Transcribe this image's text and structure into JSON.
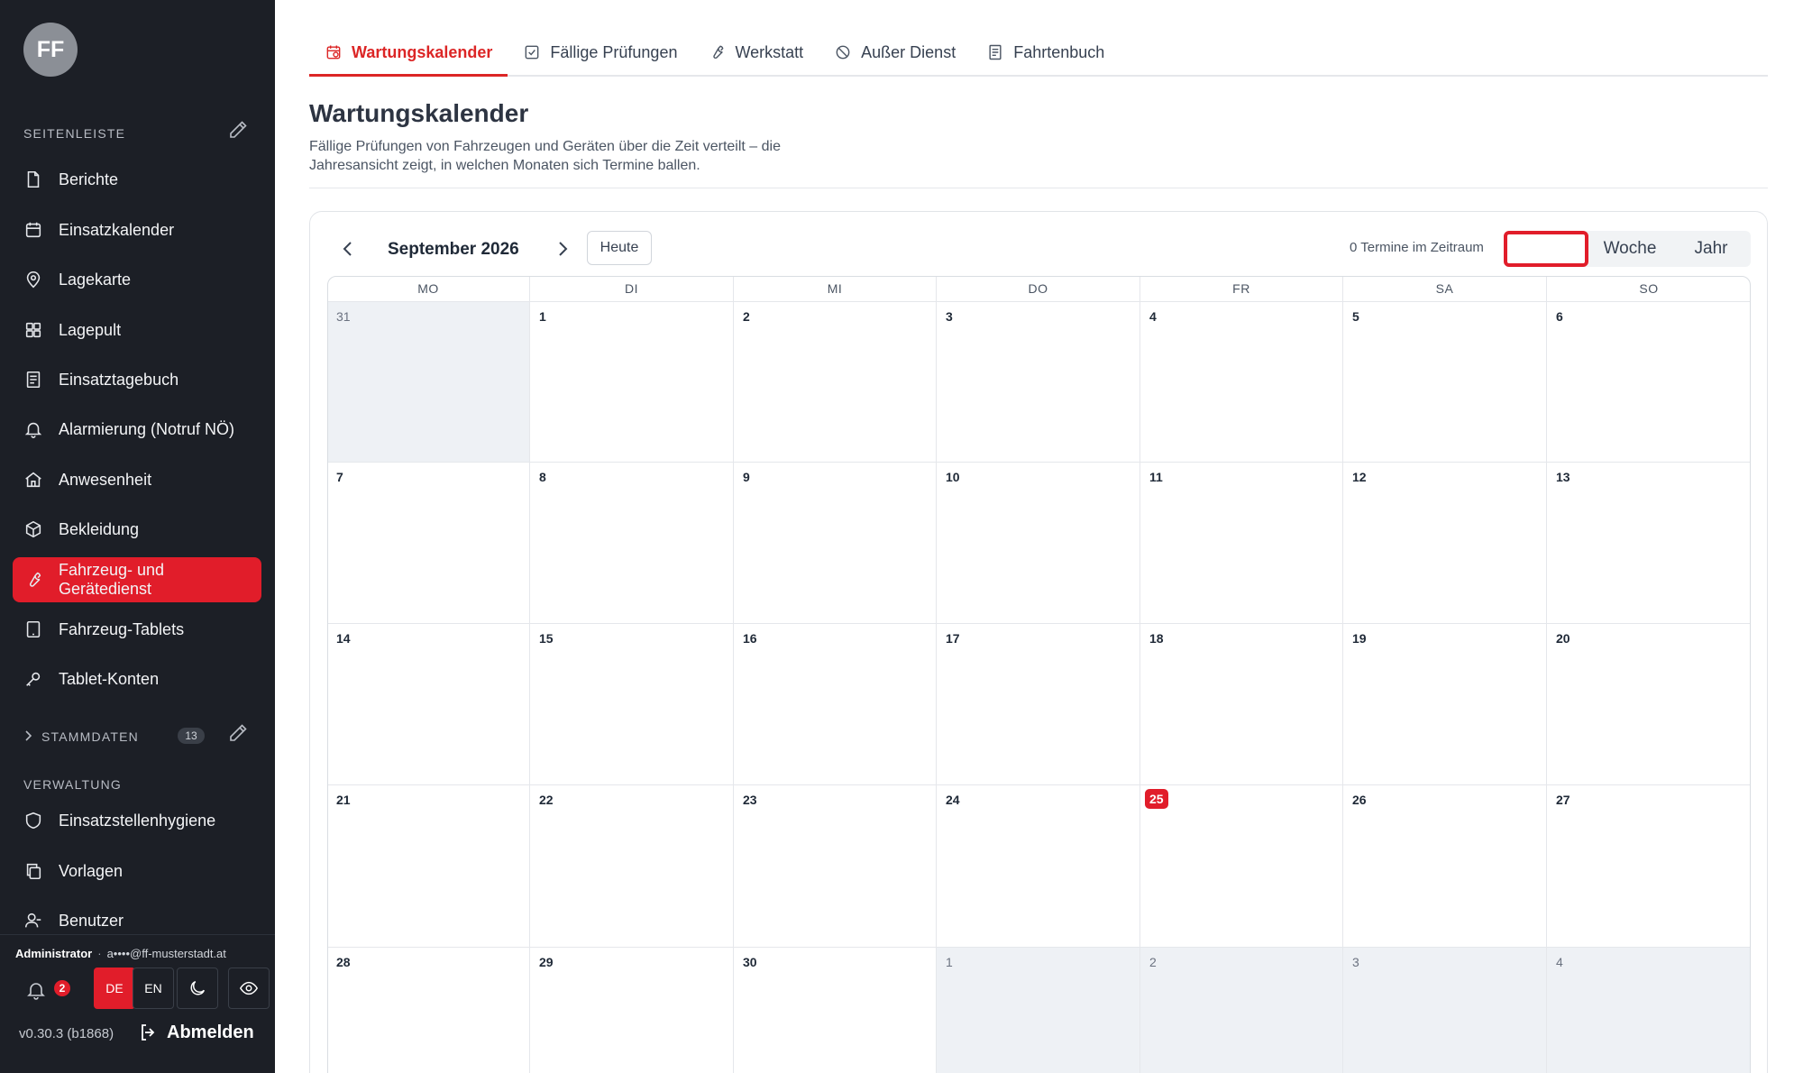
{
  "sidebar": {
    "avatar_initials": "FF",
    "section_label": "SEITENLEISTE",
    "items": [
      {
        "label": "Berichte",
        "icon": "file-icon"
      },
      {
        "label": "Einsatzkalender",
        "icon": "calendar-icon"
      },
      {
        "label": "Lagekarte",
        "icon": "map-pin-icon"
      },
      {
        "label": "Lagepult",
        "icon": "grid-icon"
      },
      {
        "label": "Einsatztagebuch",
        "icon": "notebook-icon"
      },
      {
        "label": "Alarmierung (Notruf NÖ)",
        "icon": "bell-icon"
      },
      {
        "label": "Anwesenheit",
        "icon": "home-icon"
      },
      {
        "label": "Bekleidung",
        "icon": "box-icon"
      },
      {
        "label": "Fahrzeug- und Gerätedienst",
        "icon": "wrench-icon",
        "active": true
      },
      {
        "label": "Fahrzeug-Tablets",
        "icon": "tablet-icon"
      },
      {
        "label": "Tablet-Konten",
        "icon": "key-icon"
      }
    ],
    "stammdaten_label": "STAMMDATEN",
    "stammdaten_count": "13",
    "verwaltung_label": "VERWALTUNG",
    "verwaltung_items": [
      {
        "label": "Einsatzstellenhygiene",
        "icon": "shield-icon"
      },
      {
        "label": "Vorlagen",
        "icon": "copy-icon"
      },
      {
        "label": "Benutzer",
        "icon": "user-icon"
      }
    ],
    "footer": {
      "role": "Administrator",
      "email": "a••••@ff-musterstadt.at",
      "notification_count": "2",
      "lang_de": "DE",
      "lang_en": "EN",
      "version": "v0.30.3 (b1868)",
      "logout_label": "Abmelden"
    }
  },
  "tabs": [
    {
      "label": "Wartungskalender",
      "icon": "calendar-clock-icon",
      "active": true
    },
    {
      "label": "Fällige Prüfungen",
      "icon": "checkbox-icon"
    },
    {
      "label": "Werkstatt",
      "icon": "wrench-icon"
    },
    {
      "label": "Außer Dienst",
      "icon": "ban-icon"
    },
    {
      "label": "Fahrtenbuch",
      "icon": "notebook-icon"
    }
  ],
  "page": {
    "title": "Wartungskalender",
    "description": "Fällige Prüfungen von Fahrzeugen und Geräten über die Zeit verteilt – die Jahresansicht zeigt, in welchen Monaten sich Termine ballen."
  },
  "calendar": {
    "month_label": "September 2026",
    "today_label": "Heute",
    "count_label": "0 Termine im Zeitraum",
    "views": {
      "month": "",
      "week": "Woche",
      "year": "Jahr"
    },
    "weekdays": [
      "MO",
      "DI",
      "MI",
      "DO",
      "FR",
      "SA",
      "SO"
    ],
    "weeks": [
      [
        {
          "d": "31",
          "o": true
        },
        {
          "d": "1"
        },
        {
          "d": "2"
        },
        {
          "d": "3"
        },
        {
          "d": "4"
        },
        {
          "d": "5"
        },
        {
          "d": "6"
        }
      ],
      [
        {
          "d": "7"
        },
        {
          "d": "8"
        },
        {
          "d": "9"
        },
        {
          "d": "10"
        },
        {
          "d": "11"
        },
        {
          "d": "12"
        },
        {
          "d": "13"
        }
      ],
      [
        {
          "d": "14"
        },
        {
          "d": "15"
        },
        {
          "d": "16"
        },
        {
          "d": "17"
        },
        {
          "d": "18"
        },
        {
          "d": "19"
        },
        {
          "d": "20"
        }
      ],
      [
        {
          "d": "21"
        },
        {
          "d": "22"
        },
        {
          "d": "23"
        },
        {
          "d": "24"
        },
        {
          "d": "25",
          "t": true
        },
        {
          "d": "26"
        },
        {
          "d": "27"
        }
      ],
      [
        {
          "d": "28"
        },
        {
          "d": "29"
        },
        {
          "d": "30"
        },
        {
          "d": "1",
          "o": true
        },
        {
          "d": "2",
          "o": true
        },
        {
          "d": "3",
          "o": true
        },
        {
          "d": "4",
          "o": true
        }
      ]
    ]
  },
  "colors": {
    "accent": "#e11d2a",
    "sidebar_bg": "#1c1f26",
    "outside_day_bg": "#eef1f5"
  }
}
